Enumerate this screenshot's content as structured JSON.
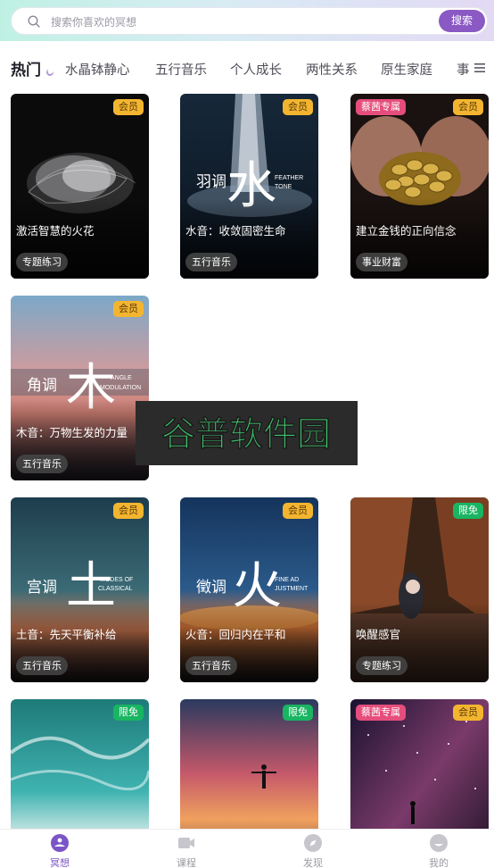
{
  "search": {
    "placeholder": "搜索你喜欢的冥想",
    "button": "搜索"
  },
  "tabs": [
    "热门",
    "水晶钵静心",
    "五行音乐",
    "个人成长",
    "两性关系",
    "原生家庭",
    "事"
  ],
  "cards": [
    {
      "title": "激活智慧的火花",
      "tag": "专题练习",
      "badge": "会员",
      "excl": ""
    },
    {
      "title": "水音：收敛固密生命",
      "tag": "五行音乐",
      "badge": "会员",
      "excl": "",
      "calli": {
        "cn": "羽调",
        "glyph": "水",
        "en1": "FEATHER",
        "en2": "TONE"
      }
    },
    {
      "title": "建立金钱的正向信念",
      "tag": "事业财富",
      "badge": "会员",
      "excl": "蔡茜专属"
    },
    {
      "title": "木音：万物生发的力量",
      "tag": "五行音乐",
      "badge": "会员",
      "excl": "",
      "calli": {
        "cn": "角调",
        "glyph": "木",
        "en1": "ANGLE",
        "en2": "MODULATION"
      }
    },
    {
      "title": "土音：先天平衡补给",
      "tag": "五行音乐",
      "badge": "会员",
      "excl": "",
      "calli": {
        "cn": "宫调",
        "glyph": "土",
        "en1": "MODES OF",
        "en2": "CLASSICAL"
      }
    },
    {
      "title": "火音：回归内在平和",
      "tag": "五行音乐",
      "badge": "会员",
      "excl": "",
      "calli": {
        "cn": "徵调",
        "glyph": "火",
        "en1": "FINE AD",
        "en2": "JUSTMENT"
      }
    },
    {
      "title": "唤醒感官",
      "tag": "专题练习",
      "badge": "限免",
      "excl": ""
    },
    {
      "title": "",
      "tag": "",
      "badge": "限免",
      "excl": ""
    },
    {
      "title": "",
      "tag": "",
      "badge": "限免",
      "excl": ""
    },
    {
      "title": "",
      "tag": "",
      "badge": "会员",
      "excl": "蔡茜专属"
    }
  ],
  "watermark": "谷普软件园",
  "nav": [
    "冥想",
    "课程",
    "发现",
    "我的"
  ],
  "colors": {
    "accent": "#8a59c3",
    "vip": "#f3b530",
    "free": "#19b562",
    "exclusive": "#e54e7c",
    "watermark_green": "#3fc26a"
  }
}
